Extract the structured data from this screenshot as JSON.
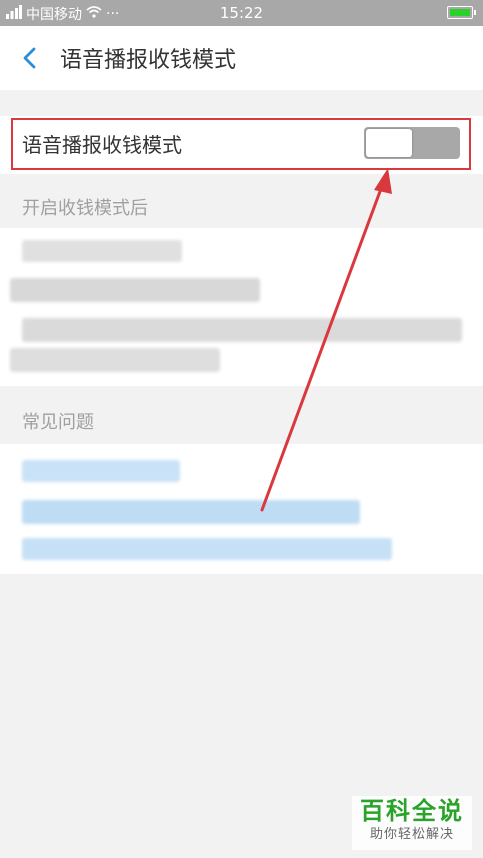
{
  "status_bar": {
    "carrier": "中国移动",
    "dots": "···",
    "time": "15:22"
  },
  "header": {
    "title": "语音播报收钱模式"
  },
  "voice_mode_row": {
    "label": "语音播报收钱模式",
    "enabled": false
  },
  "sections": {
    "after_enable_label": "开启收钱模式后",
    "faq_label": "常见问题"
  },
  "watermark": {
    "main": "百科全说",
    "sub": "助你轻松解决"
  },
  "colors": {
    "highlight": "#d9393e",
    "arrow": "#d9393e",
    "link_blur": "#bfdcf5",
    "watermark_green": "#2aa32a"
  }
}
